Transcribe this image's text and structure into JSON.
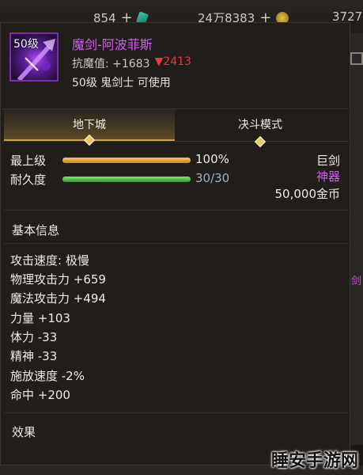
{
  "hud": {
    "gem_count": "854",
    "gold_count": "24万8383",
    "coin_count": "3727",
    "plus": "+"
  },
  "side": {
    "fragment_text": "剑"
  },
  "item": {
    "level_badge": "50级",
    "name": "魔剑-阿波菲斯",
    "resist_label": "抗魔值: +1683",
    "resist_down": "▼2413",
    "requirement": "50级 鬼剑士 可使用",
    "name_color": "#d45cf0"
  },
  "tabs": [
    {
      "label": "地下城",
      "active": true
    },
    {
      "label": "决斗模式",
      "active": false
    }
  ],
  "stats": {
    "upgrade_label": "最上级",
    "upgrade_value": "100%",
    "upgrade_fraction": 1.0,
    "durability_label": "耐久度",
    "durability_value": "30/30",
    "durability_fraction": 1.0,
    "weapon_type": "巨剑",
    "rarity": "神器",
    "price": "50,000金币"
  },
  "sections": {
    "basic_info": "基本信息",
    "effects": "效果"
  },
  "attributes": [
    "攻击速度: 极慢",
    "物理攻击力 +659",
    "魔法攻击力 +494",
    "力量 +103",
    "体力 -33",
    "精神 -33",
    "施放速度 -2%",
    "命中 +200"
  ],
  "watermark": "睡安手游网"
}
